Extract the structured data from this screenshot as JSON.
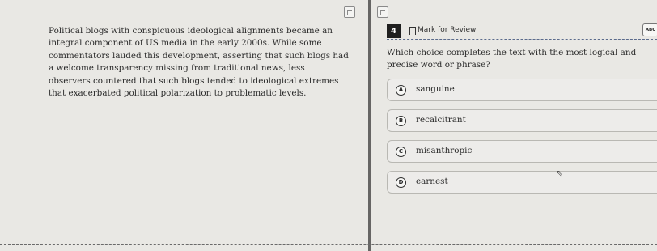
{
  "toolbar": {
    "icons": [
      "annotate-icon",
      "reference-icon"
    ]
  },
  "passage": {
    "before_blank": "Political blogs with conspicuous ideological alignments became an integral component of US media in the early 2000s. While some commentators lauded this development, asserting that such blogs had a welcome transparency missing from traditional news, less",
    "after_blank": "observers countered that such blogs tended to ideological extremes that exacerbated political polarization to problematic levels."
  },
  "question": {
    "number": "4",
    "mark_label": "Mark for Review",
    "abc_label": "ABC",
    "prompt": "Which choice completes the text with the most logical and precise word or phrase?",
    "choices": [
      {
        "letter": "A",
        "text": "sanguine"
      },
      {
        "letter": "B",
        "text": "recalcitrant"
      },
      {
        "letter": "C",
        "text": "misanthropic"
      },
      {
        "letter": "D",
        "text": "earnest"
      }
    ]
  },
  "cursor": {
    "glyph": "⇖"
  }
}
